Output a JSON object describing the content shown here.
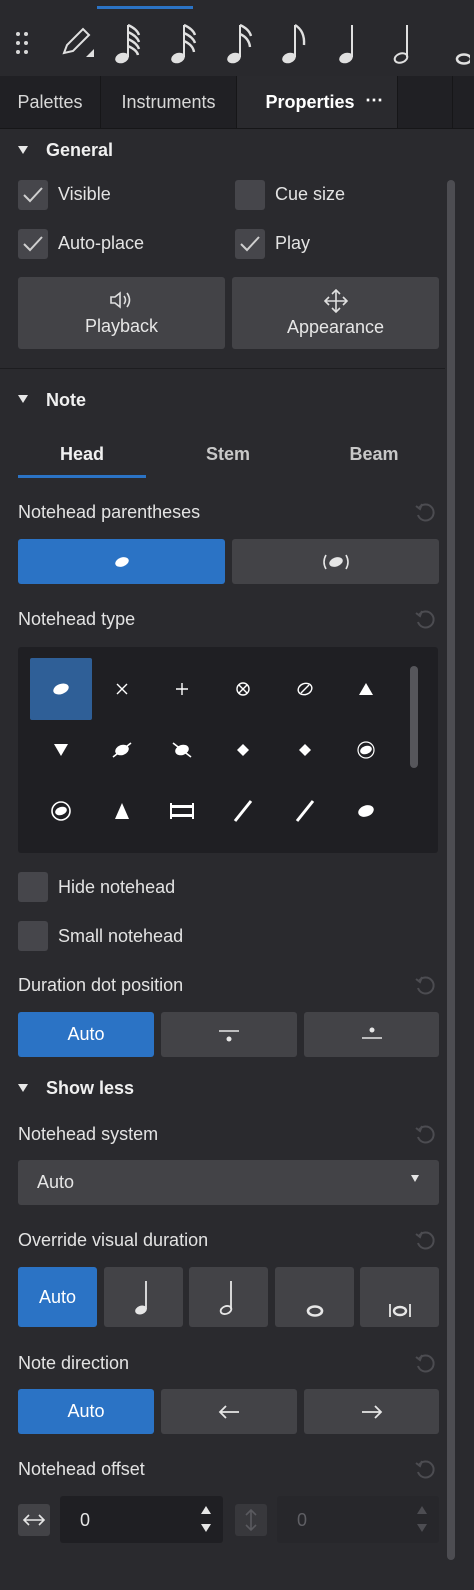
{
  "toolbar": {
    "icons": [
      "drag-handle-icon",
      "pencil-icon",
      "note-64th-icon",
      "note-32nd-icon",
      "note-16th-icon",
      "note-eighth-icon",
      "note-quarter-icon",
      "note-half-icon",
      "note-whole-icon"
    ]
  },
  "tabs": [
    "Palettes",
    "Instruments",
    "Properties"
  ],
  "general": {
    "title": "General",
    "visible": "Visible",
    "cue_size": "Cue size",
    "auto_place": "Auto-place",
    "play": "Play",
    "playback": "Playback",
    "appearance": "Appearance"
  },
  "note": {
    "title": "Note",
    "subtabs": [
      "Head",
      "Stem",
      "Beam"
    ],
    "parentheses_label": "Notehead parentheses",
    "parentheses_options": [
      "plain-notehead",
      "parenthesized-notehead"
    ],
    "type_label": "Notehead type",
    "hide_notehead": "Hide notehead",
    "small_notehead": "Small notehead",
    "dot_label": "Duration dot position",
    "dot_options": [
      "Auto"
    ],
    "show_less": "Show less",
    "system_label": "Notehead system",
    "system_value": "Auto",
    "override_label": "Override visual duration",
    "override_auto": "Auto",
    "direction_label": "Note direction",
    "direction_auto": "Auto",
    "offset_label": "Notehead offset",
    "offset_x": "0",
    "offset_y": "0"
  },
  "colors": {
    "accent": "#2b73c5",
    "panel": "#2a2a2e",
    "button": "#434347"
  }
}
